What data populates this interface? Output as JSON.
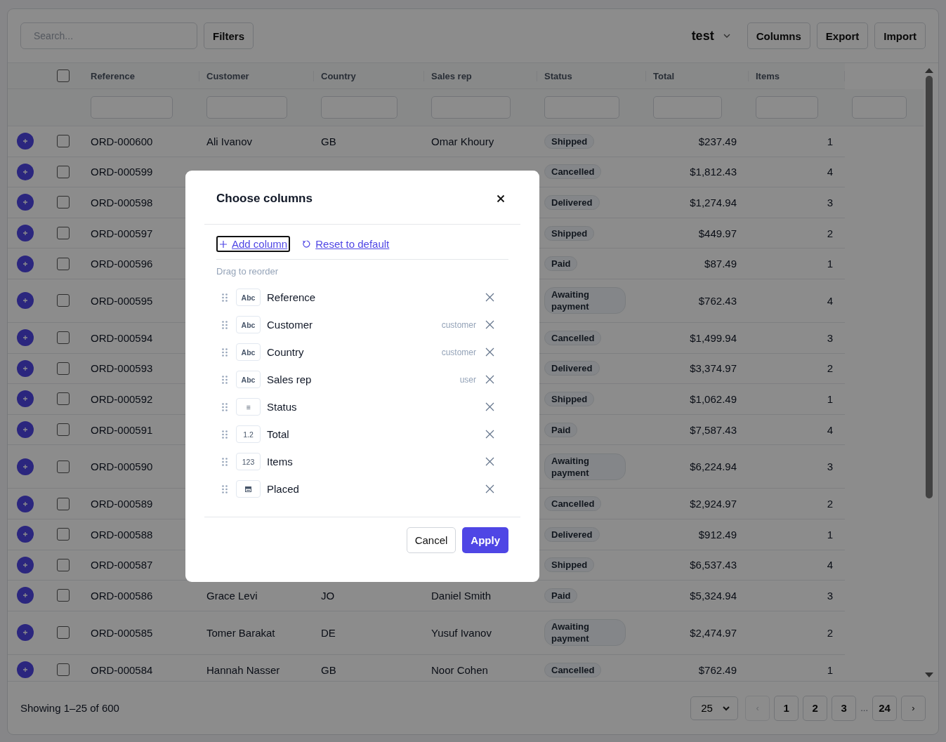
{
  "toolbar": {
    "search": {
      "placeholder": "Search..."
    },
    "filters_button": "Filters",
    "view": "test",
    "buttons": [
      "Columns",
      "Export",
      "Import"
    ]
  },
  "table": {
    "all_checked": false,
    "columns": [
      {
        "label": "Reference",
        "kind": "text"
      },
      {
        "label": "Customer",
        "kind": "text"
      },
      {
        "label": "Country",
        "kind": "text"
      },
      {
        "label": "Sales rep",
        "kind": "text"
      },
      {
        "label": "Status",
        "kind": "badge"
      },
      {
        "label": "Total",
        "kind": "number"
      },
      {
        "label": "Items",
        "kind": "number"
      }
    ],
    "rows": [
      {
        "checked": false,
        "reference": "ORD-000600",
        "customer": "Ali Ivanov",
        "country": "GB",
        "sales_rep": "Omar Khoury",
        "status": "Shipped",
        "total": "$237.49",
        "items": "1"
      },
      {
        "checked": false,
        "reference": "ORD-000599",
        "status": "Cancelled",
        "total": "$1,812.43",
        "items": "4"
      },
      {
        "checked": false,
        "reference": "ORD-000598",
        "status": "Delivered",
        "total": "$1,274.94",
        "items": "3"
      },
      {
        "checked": false,
        "reference": "ORD-000597",
        "status": "Shipped",
        "total": "$449.97",
        "items": "2"
      },
      {
        "checked": false,
        "reference": "ORD-000596",
        "status": "Paid",
        "total": "$87.49",
        "items": "1"
      },
      {
        "checked": false,
        "reference": "ORD-000595",
        "status": "Awaiting payment",
        "total": "$762.43",
        "items": "4"
      },
      {
        "checked": false,
        "reference": "ORD-000594",
        "status": "Cancelled",
        "total": "$1,499.94",
        "items": "3"
      },
      {
        "checked": false,
        "reference": "ORD-000593",
        "status": "Delivered",
        "total": "$3,374.97",
        "items": "2"
      },
      {
        "checked": false,
        "reference": "ORD-000592",
        "status": "Shipped",
        "total": "$1,062.49",
        "items": "1"
      },
      {
        "checked": false,
        "reference": "ORD-000591",
        "status": "Paid",
        "total": "$7,587.43",
        "items": "4"
      },
      {
        "checked": false,
        "reference": "ORD-000590",
        "status": "Awaiting payment",
        "total": "$6,224.94",
        "items": "3"
      },
      {
        "checked": false,
        "reference": "ORD-000589",
        "status": "Cancelled",
        "total": "$2,924.97",
        "items": "2"
      },
      {
        "checked": false,
        "reference": "ORD-000588",
        "status": "Delivered",
        "total": "$912.49",
        "items": "1"
      },
      {
        "checked": false,
        "reference": "ORD-000587",
        "status": "Shipped",
        "total": "$6,537.43",
        "items": "4"
      },
      {
        "checked": false,
        "reference": "ORD-000586",
        "customer": "Grace Levi",
        "country": "JO",
        "sales_rep": "Daniel Smith",
        "status": "Paid",
        "total": "$5,324.94",
        "items": "3"
      },
      {
        "checked": false,
        "reference": "ORD-000585",
        "customer": "Tomer Barakat",
        "country": "DE",
        "sales_rep": "Yusuf Ivanov",
        "status": "Awaiting payment",
        "total": "$2,474.97",
        "items": "2"
      },
      {
        "checked": false,
        "reference": "ORD-000584",
        "customer": "Hannah Nasser",
        "country": "GB",
        "sales_rep": "Noor Cohen",
        "status": "Cancelled",
        "total": "$762.49",
        "items": "1"
      }
    ]
  },
  "footer": {
    "summary": "Showing 1–25 of 600",
    "page_size": "25",
    "prev": {
      "label": "‹",
      "disabled": true
    },
    "pages": [
      "1",
      "2",
      "3"
    ],
    "ellipsis": "...",
    "last_page": "24",
    "next": {
      "label": "›",
      "disabled": false
    }
  },
  "dialog": {
    "title": "Choose columns",
    "add_column": {
      "label": "Add column",
      "focused": true
    },
    "reset": "Reset to default",
    "hint": "Drag to reorder",
    "columns": [
      {
        "name": "Reference",
        "kind": "text",
        "type_label": "Abc"
      },
      {
        "name": "Customer",
        "kind": "text",
        "type_label": "Abc",
        "source": "customer"
      },
      {
        "name": "Country",
        "kind": "text",
        "type_label": "Abc",
        "source": "customer"
      },
      {
        "name": "Sales rep",
        "kind": "text",
        "type_label": "Abc",
        "source": "user"
      },
      {
        "name": "Status",
        "kind": "enum",
        "type_label": "≡"
      },
      {
        "name": "Total",
        "kind": "decimal",
        "type_label": "1.2"
      },
      {
        "name": "Items",
        "kind": "integer",
        "type_label": "123"
      },
      {
        "name": "Placed",
        "kind": "date"
      }
    ],
    "cancel": "Cancel",
    "apply": "Apply"
  }
}
